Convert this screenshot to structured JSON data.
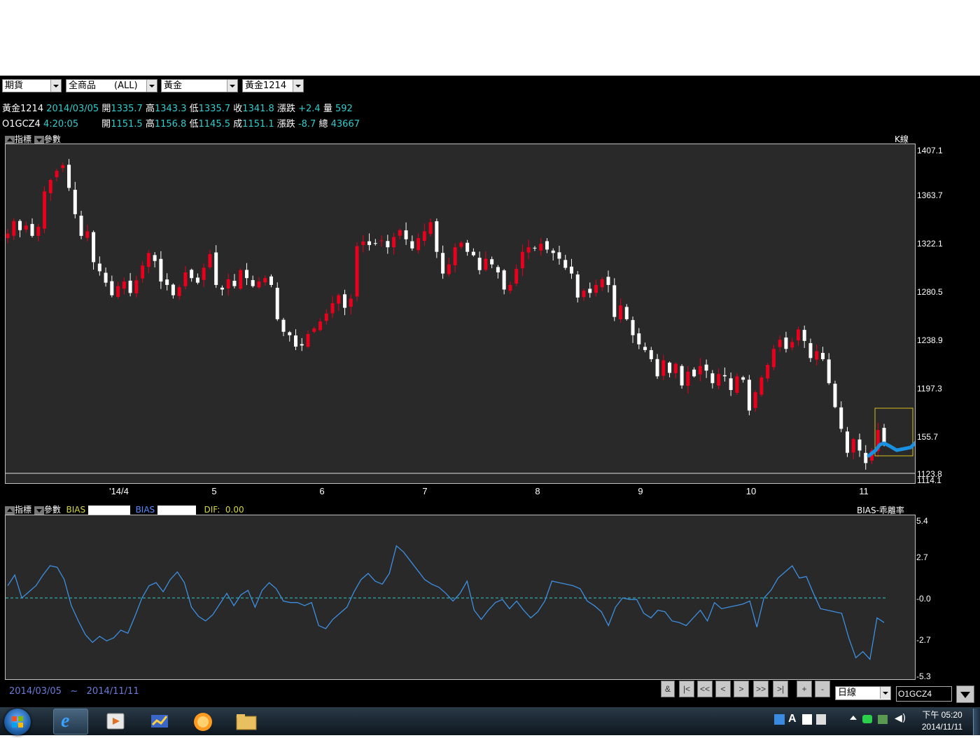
{
  "toolbar": {
    "selects": [
      "期貨",
      "全商品　　(ALL)",
      "黃金",
      "黃金1214"
    ]
  },
  "quote1": {
    "symbol": "黃金1214",
    "date": "2014/03/05",
    "open_label": "開",
    "open": "1335.7",
    "high_label": "高",
    "high": "1343.3",
    "low_label": "低",
    "low": "1335.7",
    "close_label": "收",
    "close": "1341.8",
    "chg_label": "漲跌",
    "chg": "+2.4",
    "vol_label": "量",
    "vol": "592"
  },
  "quote2": {
    "symbol": "O1GCZ4",
    "time": "4:20:05",
    "open_label": "開",
    "open": "1151.5",
    "high_label": "高",
    "high": "1156.8",
    "low_label": "低",
    "low": "1145.5",
    "close_label": "成",
    "close": "1151.1",
    "chg_label": "漲跌",
    "chg": "-8.7",
    "vol_label": "總",
    "vol": "43667"
  },
  "main_panel": {
    "indicator_label": "指標",
    "params_label": "參數",
    "title": "K線",
    "y_ticks": [
      "1407.1",
      "1363.7",
      "1322.1",
      "1280.5",
      "1238.9",
      "1197.3",
      "155.7",
      "1123.8",
      "1114.1"
    ],
    "x_ticks": [
      "'14/4",
      "5",
      "6",
      "7",
      "8",
      "9",
      "10",
      "11"
    ]
  },
  "sub_panel": {
    "indicator_label": "指標",
    "params_label": "參數",
    "bias1_label": "BIAS",
    "bias2_label": "BIAS",
    "dif_label": "DIF:",
    "dif_value": "0.00",
    "title": "BIAS-乖離率",
    "y_ticks": [
      "5.4",
      "2.7",
      "-0.0",
      "-2.7",
      "-5.3"
    ]
  },
  "footer": {
    "date_from": "2014/03/05",
    "tilde": "~",
    "date_to": "2014/11/11",
    "nav_buttons": [
      "&",
      "|<",
      "<<",
      "<",
      ">",
      ">>",
      ">|",
      "+",
      "-"
    ],
    "period": "日線",
    "symbol_input": "O1GCZ4"
  },
  "taskbar": {
    "time": "下午 05:20",
    "date": "2014/11/11"
  },
  "colors": {
    "up": "#e8001c",
    "down": "#ffffff",
    "bias": "#3d8fe0",
    "zero": "#33cccc",
    "annotation": "#1a90e0",
    "highlight_box": "#d8c020"
  },
  "chart_data": [
    {
      "type": "candlestick",
      "title": "K線",
      "x_ticks": [
        "'14/4",
        "5",
        "6",
        "7",
        "8",
        "9",
        "10",
        "11"
      ],
      "ylim": [
        1114.1,
        1407.1
      ],
      "closes": [
        1335,
        1346,
        1338,
        1342,
        1333,
        1341,
        1372,
        1382,
        1390,
        1395,
        1375,
        1352,
        1333,
        1337,
        1310,
        1302,
        1292,
        1281,
        1289,
        1293,
        1283,
        1294,
        1307,
        1318,
        1311,
        1293,
        1290,
        1281,
        1288,
        1301,
        1296,
        1292,
        1305,
        1317,
        1290,
        1286,
        1295,
        1289,
        1303,
        1296,
        1289,
        1293,
        1296,
        1290,
        1260,
        1249,
        1246,
        1236,
        1237,
        1247,
        1252,
        1258,
        1265,
        1274,
        1281,
        1270,
        1278,
        1324,
        1328,
        1325,
        1326,
        1329,
        1323,
        1332,
        1338,
        1330,
        1322,
        1331,
        1337,
        1345,
        1319,
        1300,
        1308,
        1323,
        1327,
        1319,
        1316,
        1303,
        1313,
        1308,
        1301,
        1286,
        1290,
        1304,
        1319,
        1323,
        1322,
        1326,
        1321,
        1318,
        1313,
        1305,
        1300,
        1279,
        1285,
        1283,
        1290,
        1295,
        1290,
        1262,
        1272,
        1260,
        1246,
        1238,
        1233,
        1225,
        1210,
        1224,
        1213,
        1221,
        1202,
        1214,
        1210,
        1219,
        1215,
        1204,
        1212,
        1210,
        1198,
        1210,
        1207,
        1180,
        1196,
        1209,
        1220,
        1234,
        1242,
        1234,
        1240,
        1251,
        1241,
        1226,
        1232,
        1225,
        1204,
        1183,
        1164,
        1143,
        1155,
        1145,
        1134,
        1145,
        1163,
        1152
      ],
      "series": [
        {
          "name": "黃金",
          "values": []
        }
      ]
    },
    {
      "type": "line",
      "title": "BIAS-乖離率",
      "ylim": [
        -5.3,
        5.4
      ],
      "values": [
        0.8,
        1.5,
        0.0,
        0.4,
        0.8,
        1.5,
        2.1,
        2.0,
        1.2,
        -0.5,
        -1.5,
        -2.4,
        -2.9,
        -2.5,
        -2.8,
        -2.6,
        -2.1,
        -2.3,
        -1.2,
        0.0,
        0.8,
        1.0,
        0.4,
        1.2,
        1.7,
        1.0,
        -0.6,
        -1.2,
        -1.5,
        -1.1,
        -0.4,
        0.3,
        -0.5,
        0.2,
        0.5,
        -0.6,
        0.5,
        1.0,
        0.6,
        -0.2,
        -0.3,
        -0.3,
        -0.5,
        -0.3,
        -1.8,
        -2.0,
        -1.4,
        -1.0,
        -0.6,
        0.4,
        1.2,
        1.6,
        1.1,
        0.9,
        1.6,
        3.4,
        3.0,
        2.4,
        1.8,
        1.2,
        0.9,
        0.7,
        0.3,
        -0.2,
        0.3,
        1.1,
        -0.8,
        -1.4,
        -0.8,
        -0.3,
        -0.1,
        -0.7,
        -0.2,
        -0.8,
        -1.3,
        -0.9,
        -0.2,
        1.1,
        1.0,
        0.9,
        0.8,
        0.6,
        -0.2,
        -0.5,
        -0.9,
        -1.8,
        -0.6,
        0.0,
        -0.1,
        -0.1,
        -1.0,
        -1.3,
        -0.8,
        -0.9,
        -1.5,
        -1.6,
        -1.8,
        -1.3,
        -0.8,
        -1.5,
        -0.3,
        -0.7,
        -0.6,
        -0.5,
        -0.4,
        -0.2,
        -1.9,
        0.0,
        0.5,
        1.3,
        1.7,
        2.1,
        1.3,
        1.4,
        0.3,
        -0.7,
        -0.8,
        -0.9,
        -1.0,
        -2.6,
        -3.9,
        -3.5,
        -4.0,
        -1.3,
        -1.6
      ]
    }
  ]
}
